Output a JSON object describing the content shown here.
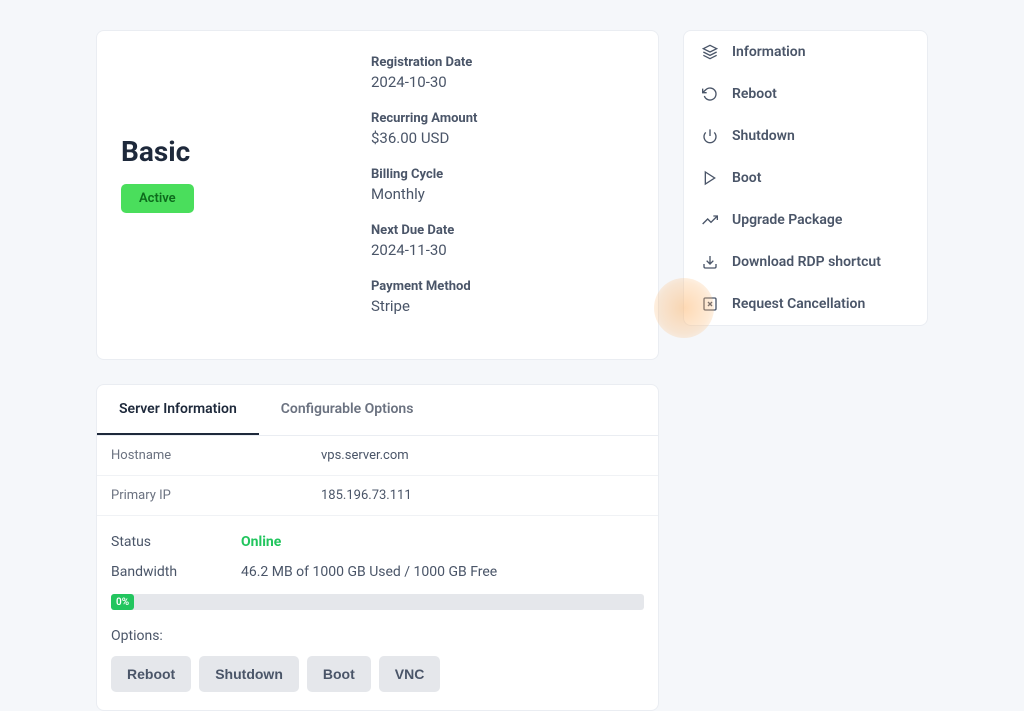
{
  "plan": {
    "name": "Basic",
    "status": "Active"
  },
  "details": {
    "registration_date_label": "Registration Date",
    "registration_date": "2024-10-30",
    "recurring_amount_label": "Recurring Amount",
    "recurring_amount": "$36.00 USD",
    "billing_cycle_label": "Billing Cycle",
    "billing_cycle": "Monthly",
    "next_due_date_label": "Next Due Date",
    "next_due_date": "2024-11-30",
    "payment_method_label": "Payment Method",
    "payment_method": "Stripe"
  },
  "tabs": {
    "server_info": "Server Information",
    "configurable": "Configurable Options"
  },
  "server": {
    "hostname_label": "Hostname",
    "hostname": "vps.server.com",
    "primary_ip_label": "Primary IP",
    "primary_ip": "185.196.73.111",
    "status_label": "Status",
    "status": "Online",
    "bandwidth_label": "Bandwidth",
    "bandwidth": "46.2 MB of 1000 GB Used / 1000 GB Free",
    "bandwidth_pct": "0%",
    "options_label": "Options:"
  },
  "actions": {
    "reboot": "Reboot",
    "shutdown": "Shutdown",
    "boot": "Boot",
    "vnc": "VNC"
  },
  "sidebar": {
    "information": "Information",
    "reboot": "Reboot",
    "shutdown": "Shutdown",
    "boot": "Boot",
    "upgrade": "Upgrade Package",
    "download_rdp": "Download RDP shortcut",
    "request_cancel": "Request Cancellation"
  }
}
